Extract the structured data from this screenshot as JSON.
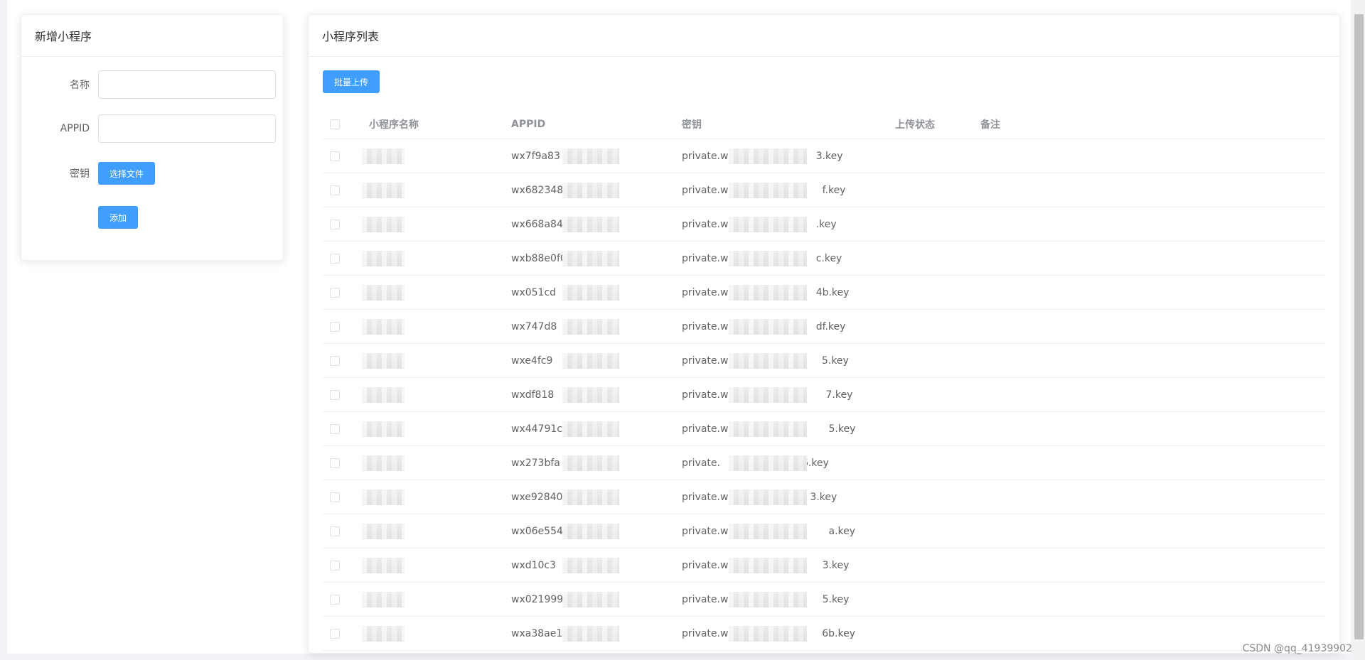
{
  "left_panel": {
    "title": "新增小程序",
    "name_label": "名称",
    "appid_label": "APPID",
    "key_label": "密钥",
    "choose_file_label": "选择文件",
    "add_label": "添加"
  },
  "right_panel": {
    "title": "小程序列表",
    "batch_upload_label": "批量上传",
    "columns": [
      "小程序名称",
      "APPID",
      "密钥",
      "上传状态",
      "备注"
    ],
    "rows": [
      {
        "name": "",
        "appid": "wx7f9a83",
        "key_prefix": "private.wx",
        "key_suffix": "3.key"
      },
      {
        "name": "",
        "appid": "wx6823488",
        "key_prefix": "private.wx6",
        "key_suffix": "f.key"
      },
      {
        "name": "",
        "appid": "wx668a842",
        "key_prefix": "private.wx",
        "key_suffix": ".key"
      },
      {
        "name": "",
        "appid": "wxb88e0f0",
        "key_prefix": "private.wx",
        "key_suffix": "c.key"
      },
      {
        "name": "",
        "appid": "wx051cd",
        "key_prefix": "private.wx",
        "key_suffix": "4b.key"
      },
      {
        "name": "",
        "appid": "wx747d8",
        "key_prefix": "private.wx",
        "key_suffix": "df.key"
      },
      {
        "name": "",
        "appid": "wxe4fc9",
        "key_prefix": "private.wxe",
        "key_suffix": "5.key"
      },
      {
        "name": "",
        "appid": "wxdf818",
        "key_prefix": "private.wxdf",
        "key_suffix": "7.key"
      },
      {
        "name": "",
        "appid": "wx44791c",
        "key_prefix": "private.wx44",
        "key_suffix": "5.key"
      },
      {
        "name": "",
        "appid": "wx273bfa",
        "key_prefix": "private.",
        "key_suffix": "6.key"
      },
      {
        "name": "",
        "appid": "wxe92840",
        "key_prefix": "private.w",
        "key_suffix": "3.key"
      },
      {
        "name": "",
        "appid": "wx06e554",
        "key_prefix": "private.wx06",
        "key_suffix": "a.key"
      },
      {
        "name": "",
        "appid": "wxd10c3",
        "key_prefix": "private.wxd",
        "key_suffix": "3.key"
      },
      {
        "name": "",
        "appid": "wx021999",
        "key_prefix": "private.wx0",
        "key_suffix": "5.key"
      },
      {
        "name": "",
        "appid": "wxa38ae1",
        "key_prefix": "private.wxa",
        "key_suffix": "6b.key"
      }
    ]
  },
  "watermark": "CSDN @qq_41939902",
  "colors": {
    "primary": "#409eff",
    "border": "#ebeef5",
    "header_text": "#909399"
  }
}
